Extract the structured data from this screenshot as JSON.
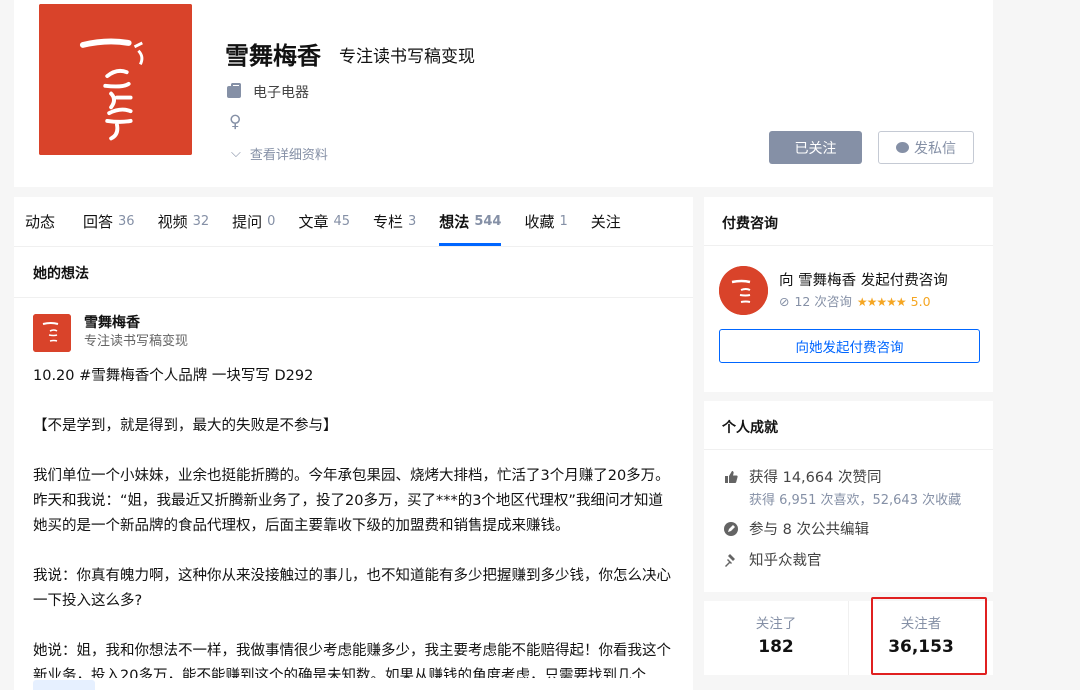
{
  "profile": {
    "name": "雪舞梅香",
    "headline": "专注读书写稿变现",
    "industry": "电子电器",
    "gender_symbol": "♀",
    "detail_link": "查看详细资料",
    "follow_button": "已关注",
    "message_button": "发私信",
    "avatar_text": "一块写写"
  },
  "tabs": [
    {
      "label": "动态",
      "count": ""
    },
    {
      "label": "回答",
      "count": "36"
    },
    {
      "label": "视频",
      "count": "32"
    },
    {
      "label": "提问",
      "count": "0"
    },
    {
      "label": "文章",
      "count": "45"
    },
    {
      "label": "专栏",
      "count": "3"
    },
    {
      "label": "想法",
      "count": "544",
      "active": true
    },
    {
      "label": "收藏",
      "count": "1"
    },
    {
      "label": "关注",
      "count": ""
    }
  ],
  "feed": {
    "section_title": "她的想法",
    "author_name": "雪舞梅香",
    "author_desc": "专注读书写稿变现",
    "paragraphs": [
      "10.20 #雪舞梅香个人品牌 一块写写 D292",
      "【不是学到，就是得到，最大的失败是不参与】",
      "我们单位一个小妹妹，业余也挺能折腾的。今年承包果园、烧烤大排档，忙活了3个月赚了20多万。昨天和我说：“姐，我最近又折腾新业务了，投了20多万，买了***的3个地区代理权”我细问才知道她买的是一个新品牌的食品代理权，后面主要靠收下级的加盟费和销售提成来赚钱。",
      "我说：你真有魄力啊，这种你从来没接触过的事儿，也不知道能有多少把握赚到多少钱，你怎么决心一下投入这么多?",
      "她说：姐，我和你想法不一样，我做事情很少考虑能赚多少，我主要考虑能不能赔得起！你看我这个新业务，投入20多万，能不能赚到这个的确是未知数。如果从赚钱的角度考虑，只需要找到几个"
    ]
  },
  "consult": {
    "title": "付费咨询",
    "line": "向 雪舞梅香 发起付费咨询",
    "count_text": "12 次咨询",
    "stars": "★★★★★",
    "rating": "5.0",
    "button": "向她发起付费咨询"
  },
  "achievements": {
    "title": "个人成就",
    "likes": "获得 14,664 次赞同",
    "likes_sub": "获得 6,951 次喜欢，52,643 次收藏",
    "edits": "参与 8 次公共编辑",
    "judge": "知乎众裁官"
  },
  "follow": {
    "following_label": "关注了",
    "following_count": "182",
    "followers_label": "关注者",
    "followers_count": "36,153"
  },
  "colors": {
    "brand_red": "#d9432a",
    "zhihu_blue": "#0066ff",
    "muted": "#8590a6",
    "highlight": "#e02020"
  }
}
